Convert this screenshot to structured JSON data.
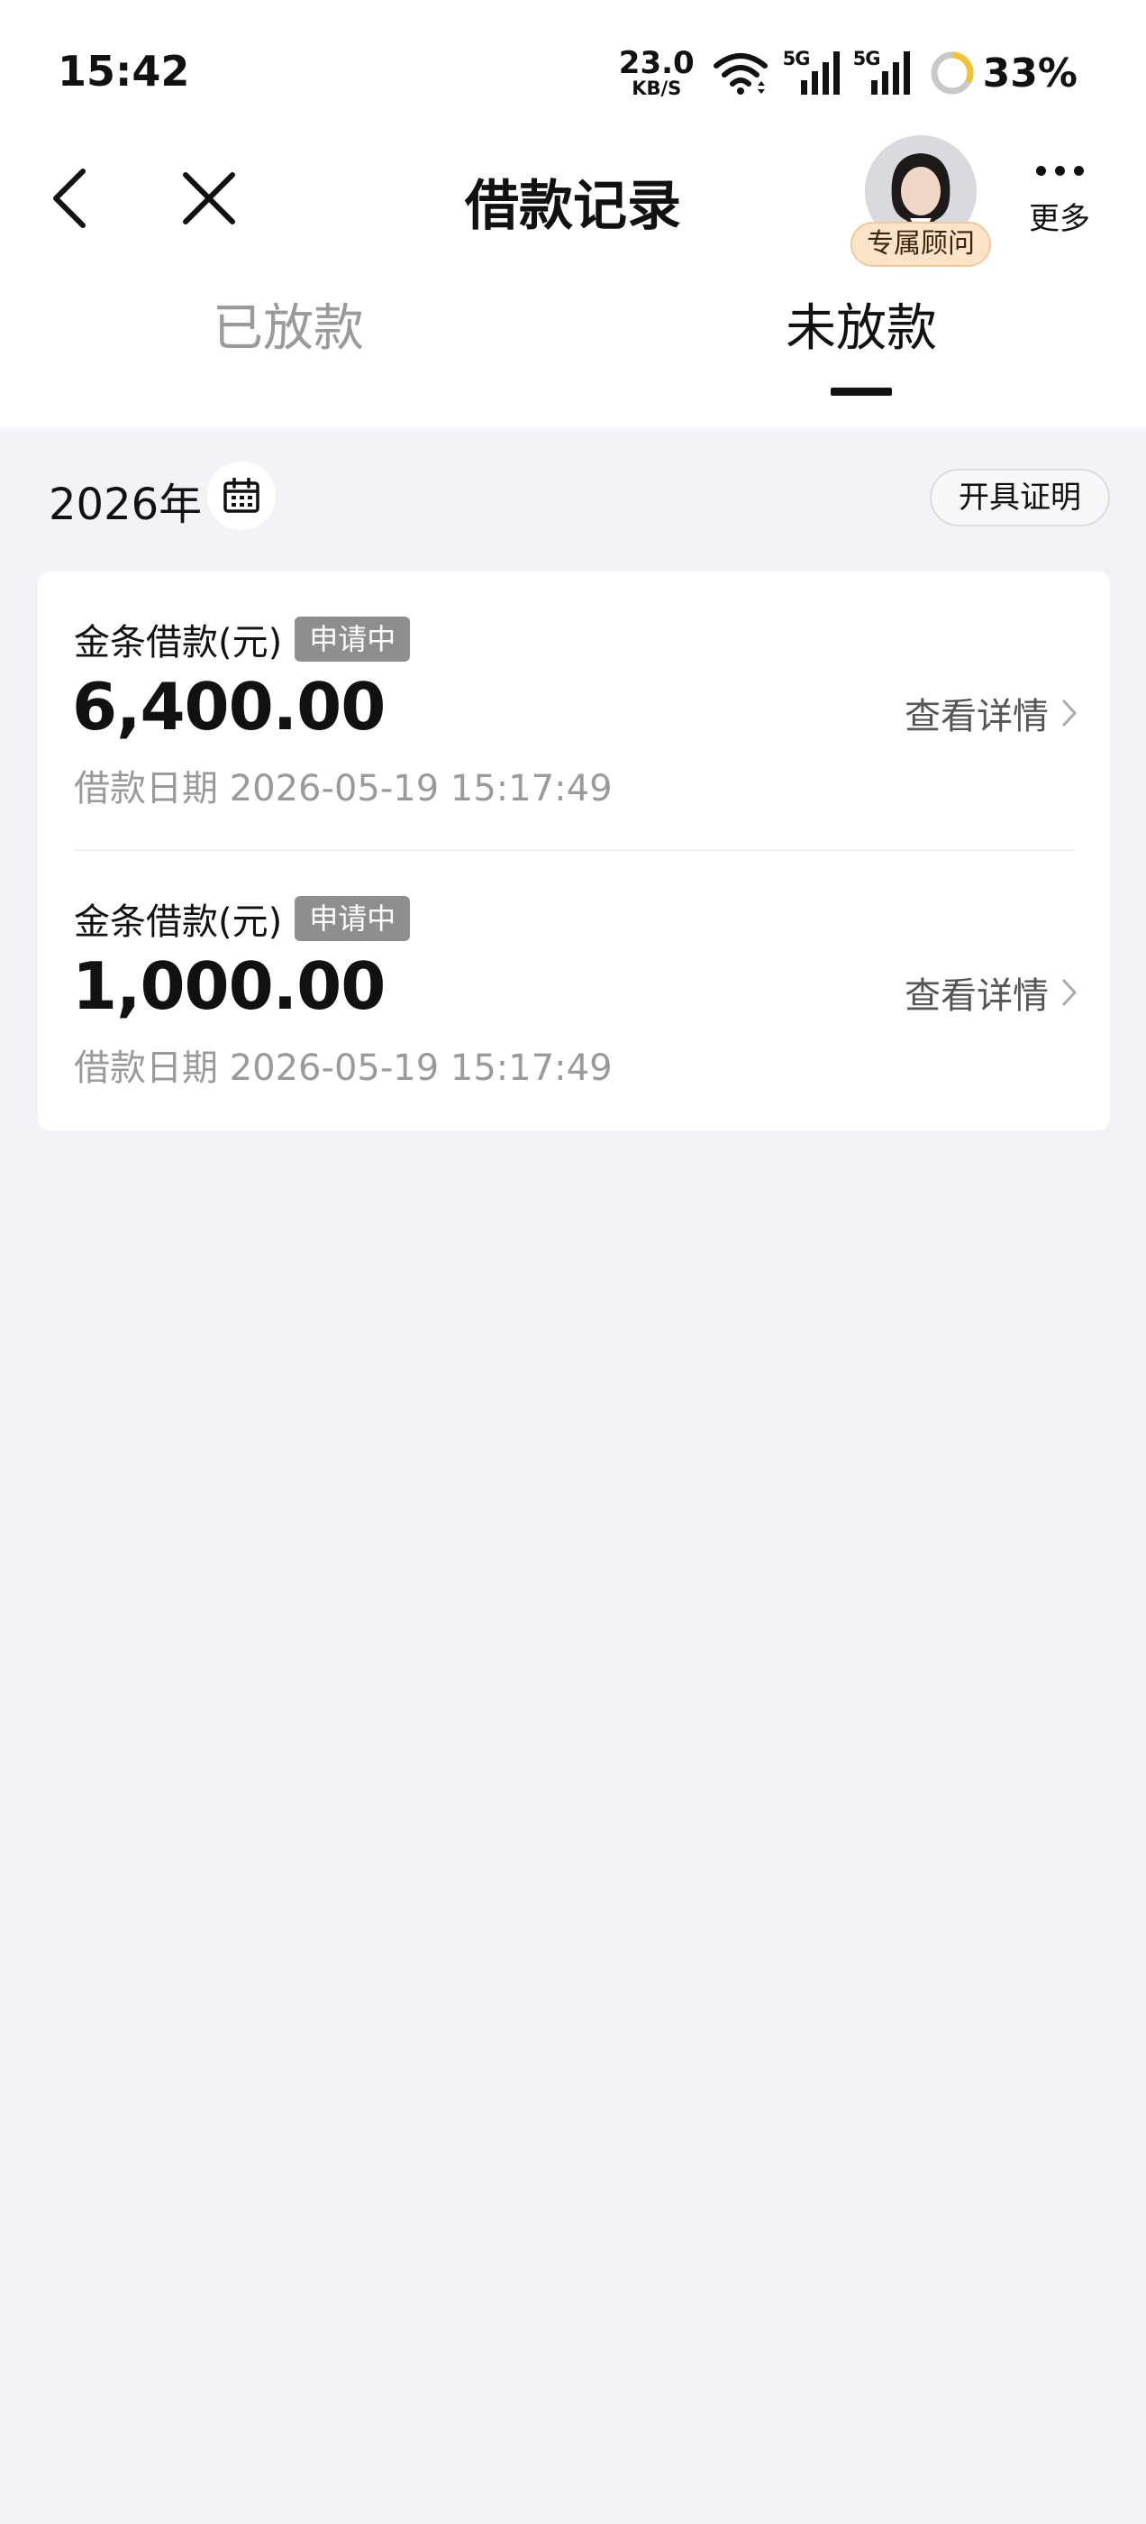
{
  "status_bar": {
    "time": "15:42",
    "net_speed": "23.0",
    "net_speed_unit": "KB/S",
    "signal_1_label": "5G",
    "signal_2_label": "5G",
    "battery": "33%",
    "battery_ring_color": "#f2c230"
  },
  "nav": {
    "title": "借款记录",
    "advisor_badge": "专属顾问",
    "more_label": "更多"
  },
  "tabs": [
    {
      "label": "已放款",
      "active": false
    },
    {
      "label": "未放款",
      "active": true
    }
  ],
  "filter": {
    "year": "2026年",
    "certificate_button": "开具证明"
  },
  "records": [
    {
      "type": "金条借款(元)",
      "status": "申请中",
      "amount": "6,400.00",
      "date": "借款日期 2026-05-19 15:17:49",
      "link": "查看详情"
    },
    {
      "type": "金条借款(元)",
      "status": "申请中",
      "amount": "1,000.00",
      "date": "借款日期 2026-05-19 15:17:49",
      "link": "查看详情"
    }
  ],
  "colors": {
    "page_background": "#f2f2f7",
    "status_tag": "#8e8e8e",
    "advisor_badge": "#fbe3c8"
  }
}
